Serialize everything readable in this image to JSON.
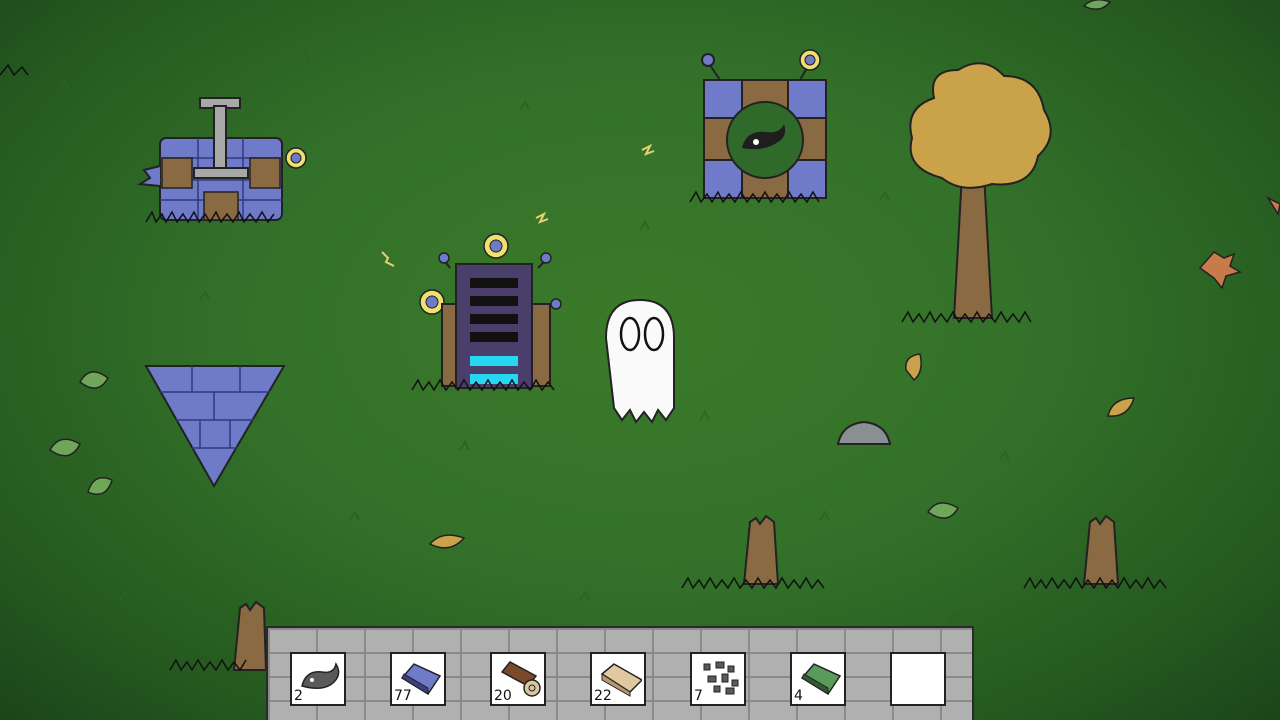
{
  "hotbar": {
    "slots": [
      {
        "item": "whale-creature-icon",
        "count": "2"
      },
      {
        "item": "metal-ingot-icon",
        "count": "77"
      },
      {
        "item": "log-icon",
        "count": "20"
      },
      {
        "item": "wood-plank-icon",
        "count": "22"
      },
      {
        "item": "stone-rubble-icon",
        "count": "7"
      },
      {
        "item": "green-ingot-icon",
        "count": "4"
      },
      {
        "item": "empty-slot",
        "count": ""
      }
    ]
  },
  "colors": {
    "grass": "#33712a",
    "machine_blue": "#6f7ac9",
    "wood": "#8a6a42",
    "hotbar_stone": "#b0b0b0",
    "energy_cyan": "#27d6f0",
    "tree_leaves": "#c9a24a"
  }
}
